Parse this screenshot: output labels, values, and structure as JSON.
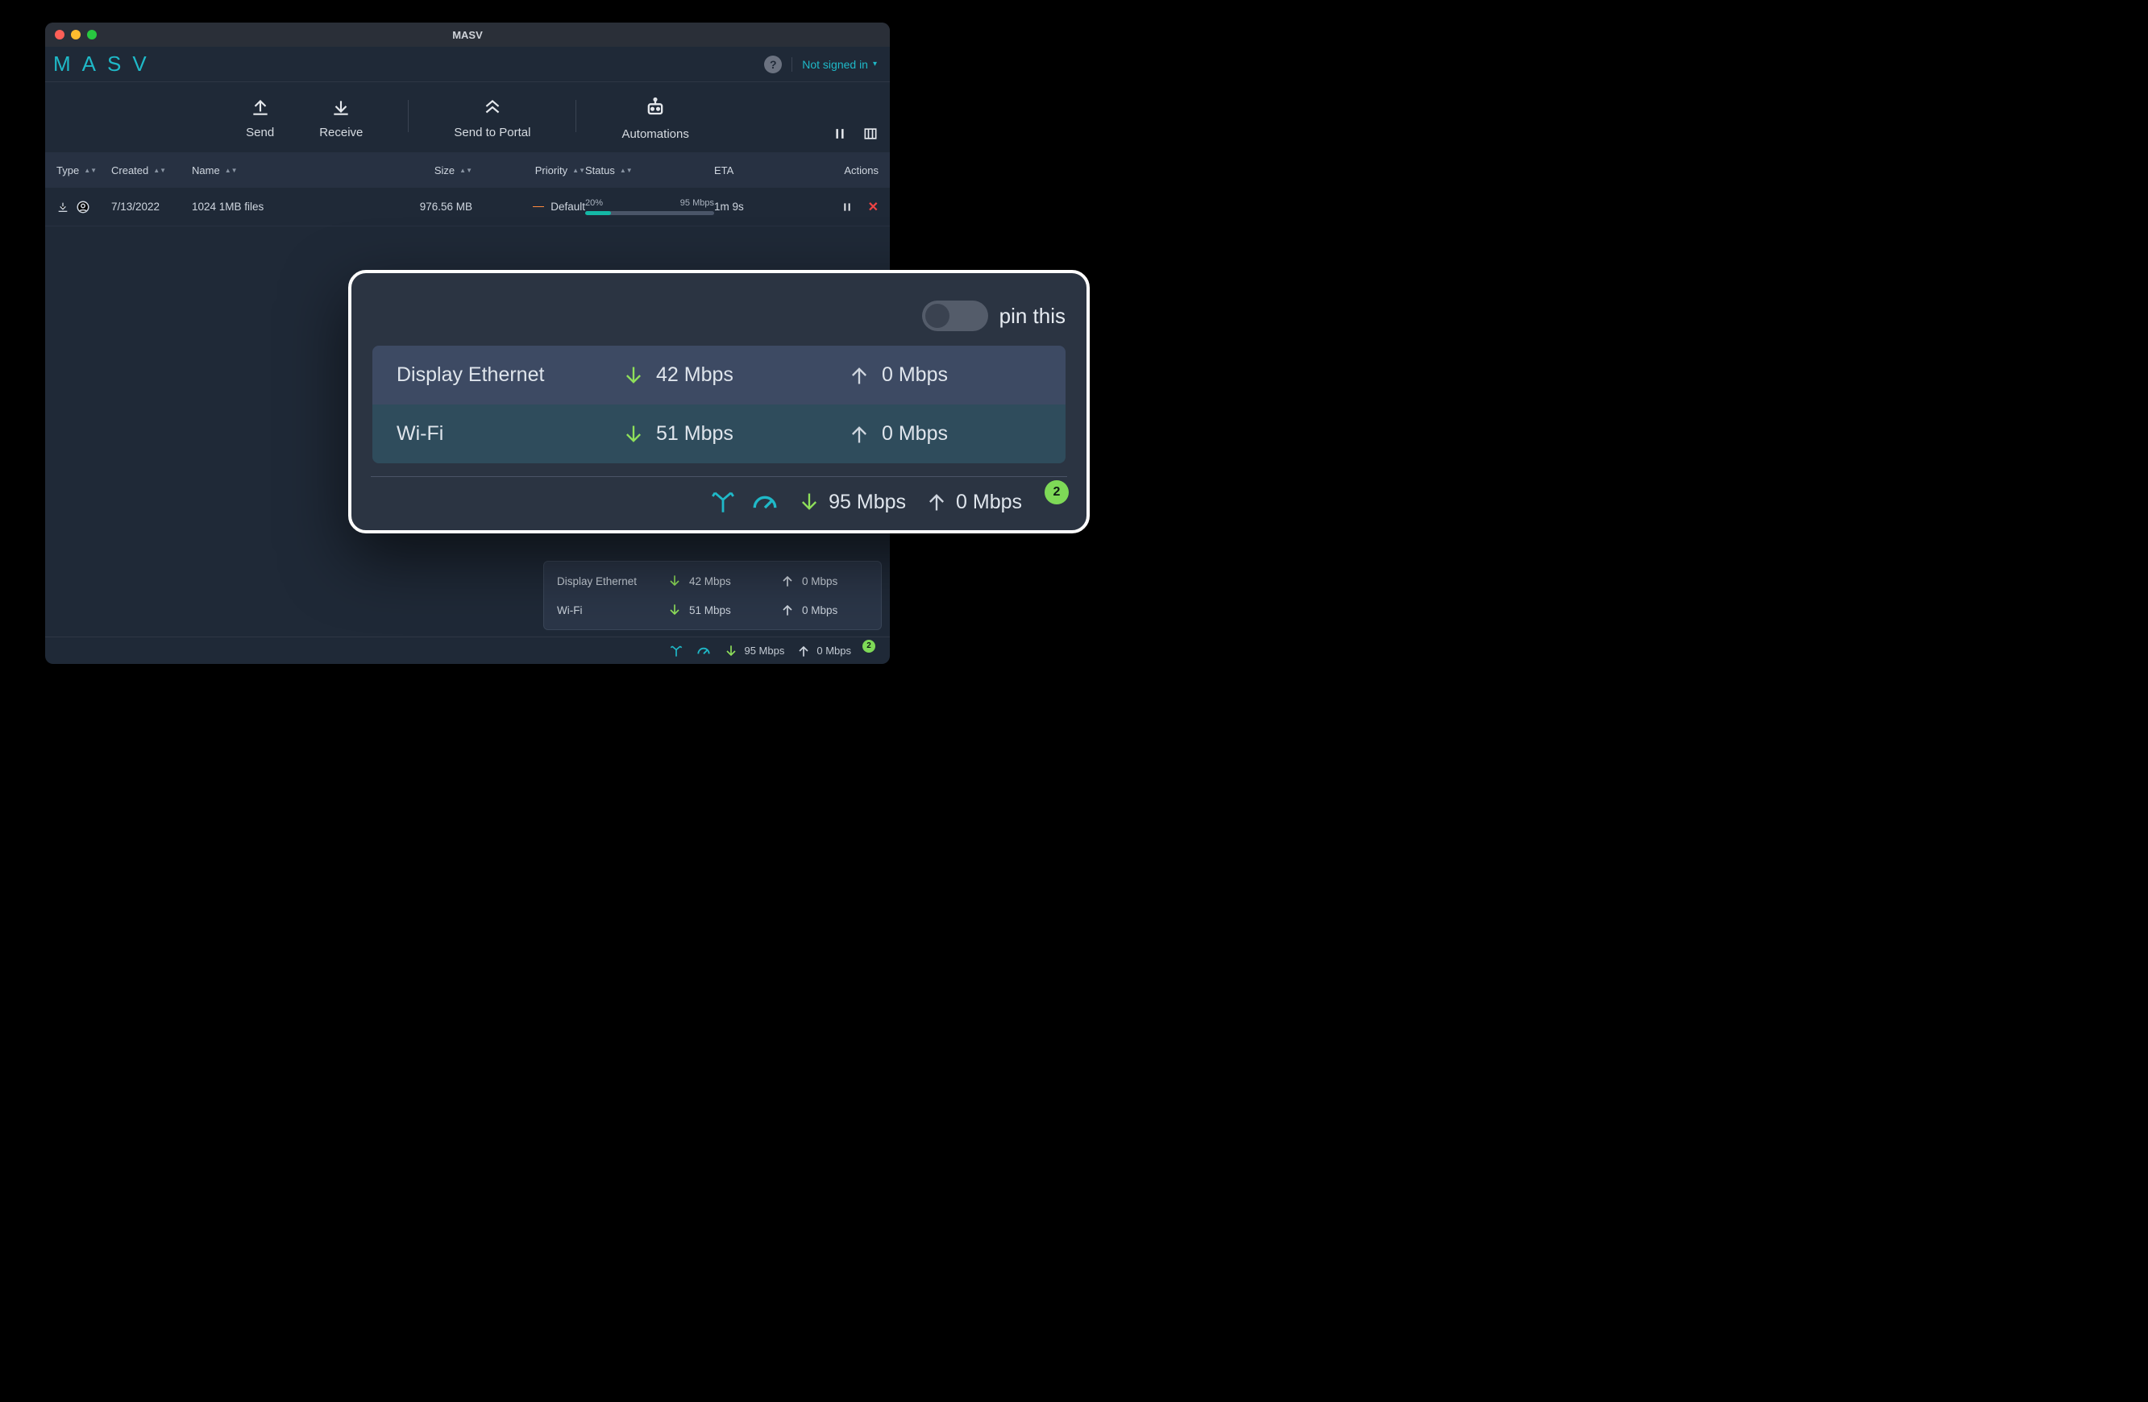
{
  "window": {
    "title": "MASV"
  },
  "brand": "MASV",
  "header": {
    "help_tooltip": "?",
    "signin_label": "Not signed in"
  },
  "toolbar": {
    "send": "Send",
    "receive": "Receive",
    "send_to_portal": "Send to Portal",
    "automations": "Automations"
  },
  "columns": {
    "type": "Type",
    "created": "Created",
    "name": "Name",
    "size": "Size",
    "priority": "Priority",
    "status": "Status",
    "eta": "ETA",
    "actions": "Actions"
  },
  "rows": [
    {
      "created": "7/13/2022",
      "name": "1024 1MB files",
      "size": "976.56 MB",
      "priority": "Default",
      "status_percent_label": "20%",
      "status_percent": 20,
      "status_rate": "95 Mbps",
      "eta": "1m 9s"
    }
  ],
  "footer": {
    "download_rate": "95 Mbps",
    "upload_rate": "0 Mbps",
    "badge": "2"
  },
  "mini_popover": {
    "rows": [
      {
        "name": "Display Ethernet",
        "down": "42 Mbps",
        "up": "0 Mbps"
      },
      {
        "name": "Wi-Fi",
        "down": "51 Mbps",
        "up": "0 Mbps"
      }
    ]
  },
  "popover": {
    "pin_label": "pin this",
    "interfaces": [
      {
        "name": "Display Ethernet",
        "down": "42 Mbps",
        "up": "0 Mbps"
      },
      {
        "name": "Wi-Fi",
        "down": "51 Mbps",
        "up": "0 Mbps"
      }
    ],
    "download_rate": "95 Mbps",
    "upload_rate": "0 Mbps",
    "badge": "2"
  }
}
